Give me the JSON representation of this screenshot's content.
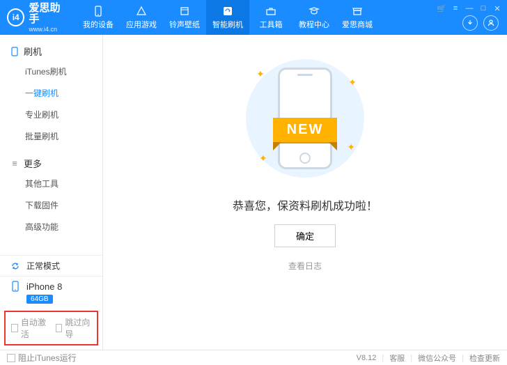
{
  "logo": {
    "badge": "i4",
    "title": "爱思助手",
    "url": "www.i4.cn"
  },
  "nav": [
    {
      "label": "我的设备"
    },
    {
      "label": "应用游戏"
    },
    {
      "label": "铃声壁纸"
    },
    {
      "label": "智能刷机"
    },
    {
      "label": "工具箱"
    },
    {
      "label": "教程中心"
    },
    {
      "label": "爱思商城"
    }
  ],
  "sidebar": {
    "group1": {
      "title": "刷机",
      "items": [
        "iTunes刷机",
        "一键刷机",
        "专业刷机",
        "批量刷机"
      ]
    },
    "group2": {
      "title": "更多",
      "items": [
        "其他工具",
        "下载固件",
        "高级功能"
      ]
    },
    "mode": "正常模式",
    "device": {
      "name": "iPhone 8",
      "storage": "64GB"
    },
    "auto_activate": "自动激活",
    "skip_wizard": "跳过向导"
  },
  "main": {
    "ribbon": "NEW",
    "message": "恭喜您，保资料刷机成功啦！",
    "ok": "确定",
    "view_log": "查看日志"
  },
  "footer": {
    "block_itunes": "阻止iTunes运行",
    "version": "V8.12",
    "service": "客服",
    "wechat": "微信公众号",
    "update": "检查更新"
  }
}
